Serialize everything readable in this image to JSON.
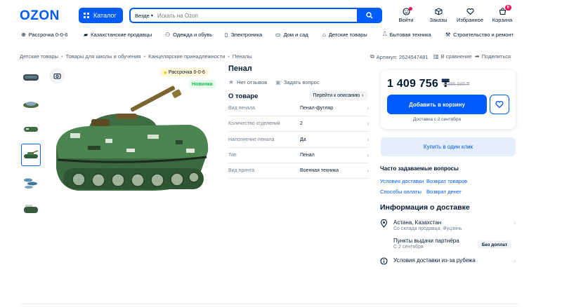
{
  "header": {
    "logo": "OZON",
    "catalog_label": "Каталог",
    "search_scope": "Везде",
    "search_placeholder": "Искать на Ozon",
    "icons": [
      {
        "name": "login",
        "label": "Войти"
      },
      {
        "name": "orders",
        "label": "Заказы"
      },
      {
        "name": "favorites",
        "label": "Избранное"
      },
      {
        "name": "cart",
        "label": "Корзина",
        "badge": "6"
      }
    ]
  },
  "nav": {
    "items": [
      "Рассрочка 0-0-6",
      "Казахстанские продавцы",
      "Одежда и обувь",
      "Электроника",
      "Дом и сад",
      "Детские товары",
      "Бытовая техника",
      "Строительство и ремонт"
    ]
  },
  "breadcrumbs": [
    "Детские товары",
    "Товары для школы и обучения",
    "Канцелярские принадлежности",
    "Пеналы"
  ],
  "product_tools": {
    "article": "Артикул: 2624547481",
    "compare": "В сравнение",
    "share": "Поделиться"
  },
  "gallery": {
    "badge_installment": "Рассрочка 0-0-6",
    "badge_new": "Новинка",
    "thumb_count": 6,
    "selected_index": 3
  },
  "product": {
    "title": "Пенал",
    "reviews": "Нет отзывов",
    "ask": "Задать вопрос",
    "about_title": "О товаре",
    "to_description": "Перейти к описанию",
    "specs": [
      {
        "label": "Вид пенала",
        "value": "Пенал-футляр"
      },
      {
        "label": "Количество отделений",
        "value": "2"
      },
      {
        "label": "Наполнение пенала",
        "value": "Да"
      },
      {
        "label": "Тип",
        "value": "Пенал"
      },
      {
        "label": "Вид принта",
        "value": "Военная техника"
      }
    ]
  },
  "buy": {
    "price": "1 409 756 ₸",
    "old_price": "2 396 585 ₸",
    "add_to_cart": "Добавить в корзину",
    "delivery_note": "Доставка с 2 сентября",
    "one_click": "Купить в один клик"
  },
  "faq": {
    "title": "Часто задаваемые вопросы",
    "links": [
      "Условия доставки",
      "Возврат товаров",
      "Способы оплаты",
      "Возврат денег"
    ]
  },
  "delivery": {
    "title": "Информация о доставке",
    "location": "Астана, Казахстан",
    "location_sub": "Со склада продавца, Фуцзянь",
    "pickup": "Пункты выдачи партнёра",
    "pickup_sub": "С 2 сентября",
    "no_prepay": "Без доплат",
    "abroad": "Условия доставки из-за рубежа"
  },
  "colors": {
    "brand": "#005bff",
    "text": "#001a34",
    "badge_pink": "#f91155",
    "new_green": "#10c44c",
    "installment_yellow": "#ffc100"
  }
}
